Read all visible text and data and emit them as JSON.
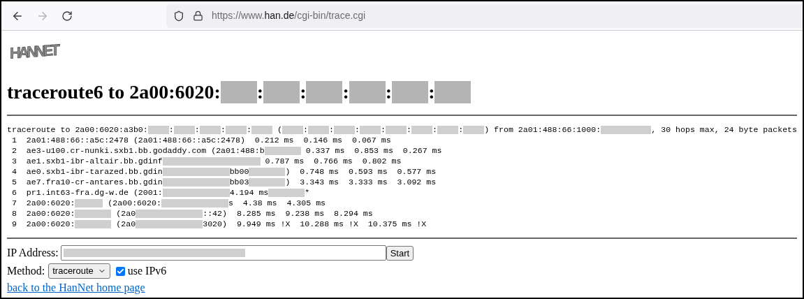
{
  "browser": {
    "back_disabled": false,
    "forward_disabled": true,
    "url": {
      "prefix": "https://www.",
      "domain": "han.de",
      "path": "/cgi-bin/trace.cgi"
    }
  },
  "logo": {
    "text": "HANNET"
  },
  "heading": [
    {
      "kind": "text",
      "text": "traceroute6 to 2a00:6020:"
    },
    {
      "kind": "blur_m"
    },
    {
      "kind": "text",
      "text": ":"
    },
    {
      "kind": "blur_m"
    },
    {
      "kind": "text",
      "text": ":"
    },
    {
      "kind": "blur_m"
    },
    {
      "kind": "text",
      "text": ":"
    },
    {
      "kind": "blur_m"
    },
    {
      "kind": "text",
      "text": ":"
    },
    {
      "kind": "blur_m"
    },
    {
      "kind": "text",
      "text": ":"
    },
    {
      "kind": "blur_m"
    }
  ],
  "output": [
    [
      {
        "kind": "text",
        "text": "traceroute to 2a00:6020:a3b0:"
      },
      {
        "kind": "blur_s"
      },
      {
        "kind": "text",
        "text": ":"
      },
      {
        "kind": "blur_s"
      },
      {
        "kind": "text",
        "text": ":"
      },
      {
        "kind": "blur_s"
      },
      {
        "kind": "text",
        "text": ":"
      },
      {
        "kind": "blur_s"
      },
      {
        "kind": "text",
        "text": ":"
      },
      {
        "kind": "blur_s"
      },
      {
        "kind": "text",
        "text": " ("
      },
      {
        "kind": "blur_s"
      },
      {
        "kind": "text",
        "text": ":"
      },
      {
        "kind": "blur_s"
      },
      {
        "kind": "text",
        "text": ":"
      },
      {
        "kind": "blur_s"
      },
      {
        "kind": "text",
        "text": ":"
      },
      {
        "kind": "blur_s"
      },
      {
        "kind": "text",
        "text": ":"
      },
      {
        "kind": "blur_s"
      },
      {
        "kind": "text",
        "text": ":"
      },
      {
        "kind": "blur_s"
      },
      {
        "kind": "text",
        "text": ":"
      },
      {
        "kind": "blur_s"
      },
      {
        "kind": "text",
        "text": ":"
      },
      {
        "kind": "blur_s"
      },
      {
        "kind": "text",
        "text": ") from 2a01:488:66:1000:"
      },
      {
        "kind": "blur_l"
      },
      {
        "kind": "text",
        "text": ", 30 hops max, 24 byte packets"
      }
    ],
    [
      {
        "kind": "text",
        "text": " 1  2a01:488:66::a5c:2478 (2a01:488:66::a5c:2478)  0.212 ms  0.146 ms  0.067 ms"
      }
    ],
    [
      {
        "kind": "text",
        "text": " 2  ae3-u100.cr-nunki.sxb1.bb.godaddy.com (2a01:488:b"
      },
      {
        "kind": "blur_m"
      },
      {
        "kind": "text",
        "text": " 0.337 ms  0.853 ms  0.267 ms"
      }
    ],
    [
      {
        "kind": "text",
        "text": " 3  ae1.sxb1-ibr-altair.bb.gdinf"
      },
      {
        "kind": "blur_xl"
      },
      {
        "kind": "text",
        "text": " 0.787 ms  0.766 ms  0.802 ms"
      }
    ],
    [
      {
        "kind": "text",
        "text": " 4  ae0.sxb1-ibr-tarazed.bb.gdin"
      },
      {
        "kind": "blur_l"
      },
      {
        "kind": "text",
        "text": "bb00"
      },
      {
        "kind": "blur_m"
      },
      {
        "kind": "text",
        "text": ")  0.748 ms  0.593 ms  0.577 ms"
      }
    ],
    [
      {
        "kind": "text",
        "text": " 5  ae7.fra10-cr-antares.bb.gdin"
      },
      {
        "kind": "blur_l"
      },
      {
        "kind": "text",
        "text": "bb03"
      },
      {
        "kind": "blur_m"
      },
      {
        "kind": "text",
        "text": ")  3.343 ms  3.333 ms  3.092 ms"
      }
    ],
    [
      {
        "kind": "text",
        "text": " 6  pr1.int63-fra.dg-w.de (2001:"
      },
      {
        "kind": "blur_l"
      },
      {
        "kind": "text",
        "text": "4.194 ms"
      },
      {
        "kind": "blur_m"
      },
      {
        "kind": "text",
        "text": "*"
      }
    ],
    [
      {
        "kind": "text",
        "text": " 7  2a00:6020:"
      },
      {
        "kind": "blur_s"
      },
      {
        "kind": "text",
        "text": " (2a00:6020:"
      },
      {
        "kind": "blur_l"
      },
      {
        "kind": "text",
        "text": "s  4.38 ms  4.305 ms"
      }
    ],
    [
      {
        "kind": "text",
        "text": " 8  2a00:6020:"
      },
      {
        "kind": "blur_m"
      },
      {
        "kind": "text",
        "text": " (2a0"
      },
      {
        "kind": "blur_l"
      },
      {
        "kind": "text",
        "text": "::42)  8.285 ms  9.238 ms  8.294 ms"
      }
    ],
    [
      {
        "kind": "text",
        "text": " 9  2a00:6020:"
      },
      {
        "kind": "blur_m"
      },
      {
        "kind": "text",
        "text": " (2a0"
      },
      {
        "kind": "blur_l"
      },
      {
        "kind": "text",
        "text": "3020)  9.949 ms !X  10.288 ms !X  10.375 ms !X"
      }
    ]
  ],
  "form": {
    "ip_label": "IP Address:",
    "ip_value_redacted": true,
    "start_button": "Start",
    "method_label": "Method:",
    "method_value": "traceroute",
    "ipv6": {
      "label": "use IPv6",
      "checked": true
    },
    "home_link": "back to the HanNet home page"
  }
}
